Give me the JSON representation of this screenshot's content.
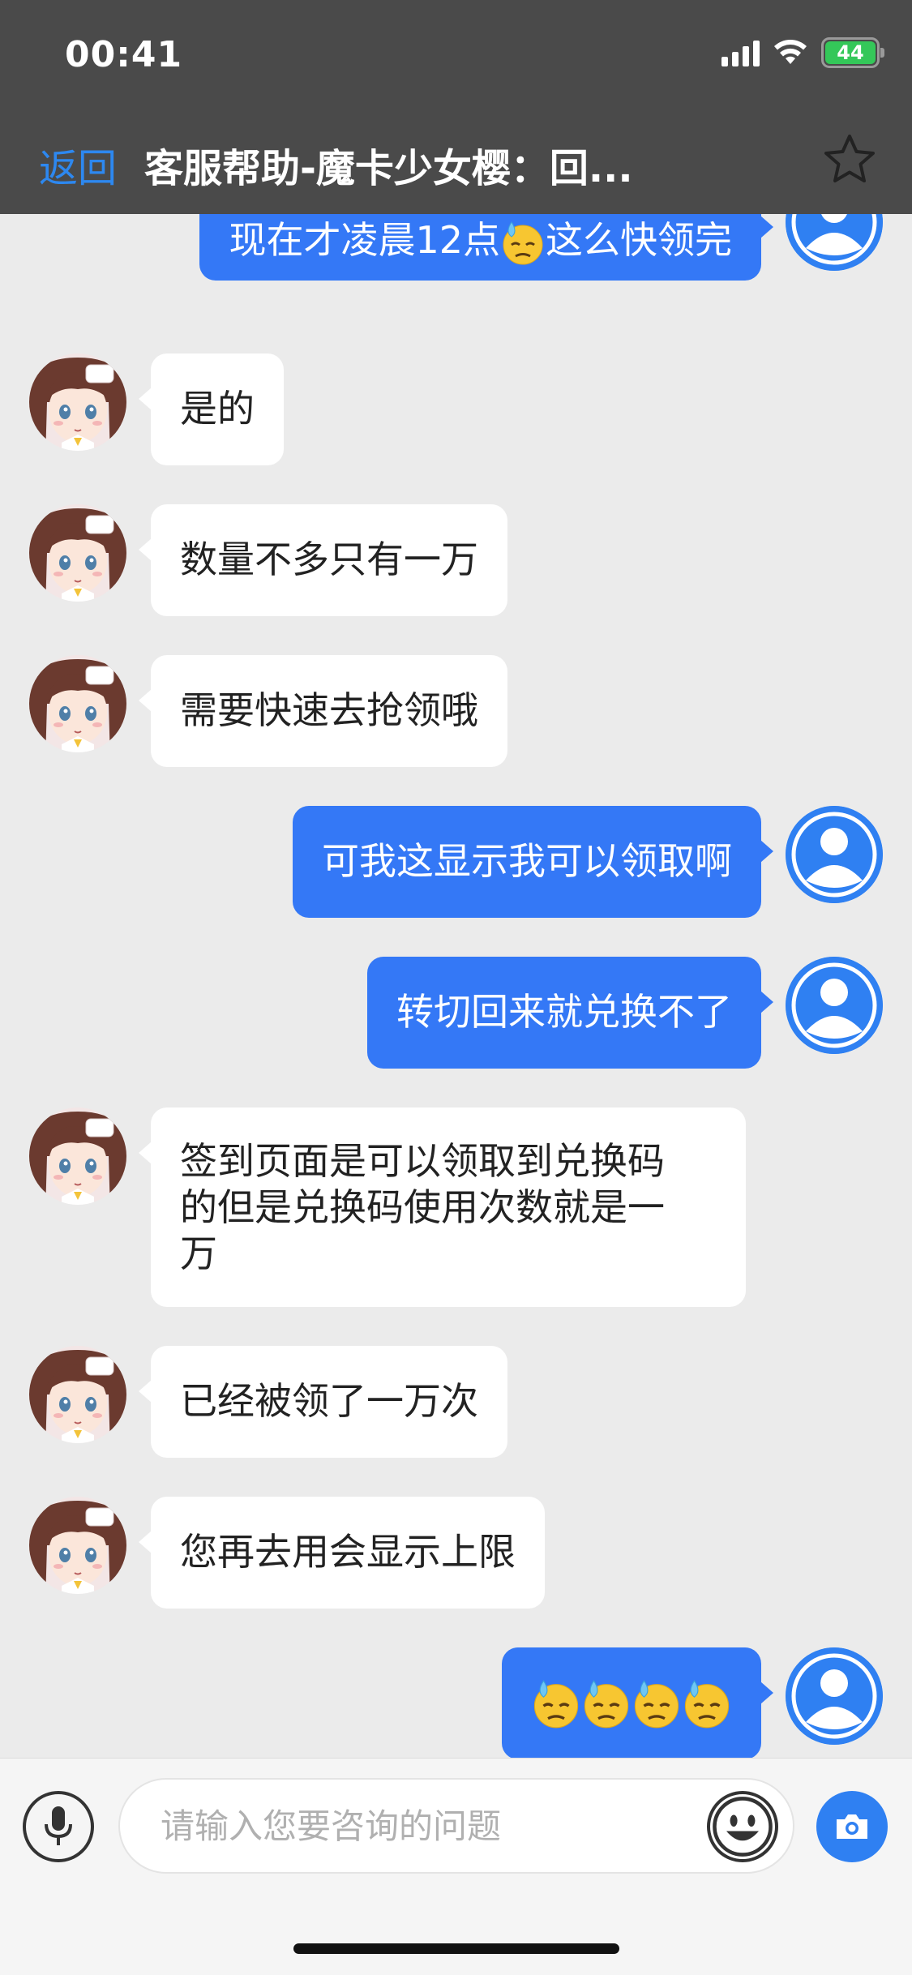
{
  "status_bar": {
    "time": "00:41",
    "battery_level": "44"
  },
  "nav": {
    "back_label": "返回",
    "title": "客服帮助-魔卡少女樱：回..."
  },
  "messages": [
    {
      "side": "out",
      "text_before": "现在才凌晨12点",
      "text_after": "这么快领完",
      "emoji": "downcast-sweat-face"
    },
    {
      "side": "in",
      "text": "是的"
    },
    {
      "side": "in",
      "text": "数量不多只有一万"
    },
    {
      "side": "in",
      "text": "需要快速去抢领哦"
    },
    {
      "side": "out",
      "text": "可我这显示我可以领取啊"
    },
    {
      "side": "out",
      "text": "转切回来就兑换不了"
    },
    {
      "side": "in",
      "lines": [
        "签到页面是可以领取到兑换码",
        "的但是兑换码使用次数就是一",
        "万"
      ]
    },
    {
      "side": "in",
      "text": "已经被领了一万次"
    },
    {
      "side": "in",
      "text": "您再去用会显示上限"
    },
    {
      "side": "out",
      "emoji": "downcast-sweat-face",
      "emoji_count": 4
    }
  ],
  "input": {
    "placeholder": "请输入您要咨询的问题"
  },
  "colors": {
    "header_bg": "#4a4a4a",
    "accent_blue": "#3478f6",
    "back_link": "#2d88f0",
    "chat_bg": "#ebebeb",
    "incoming_bubble": "#ffffff",
    "battery_green": "#34c759"
  },
  "icons": {
    "star": "star-icon",
    "mic": "microphone-icon",
    "emoji": "smiley-icon",
    "camera": "camera-icon",
    "user_avatar": "user-avatar-icon",
    "agent_avatar": "anime-girl-avatar"
  }
}
